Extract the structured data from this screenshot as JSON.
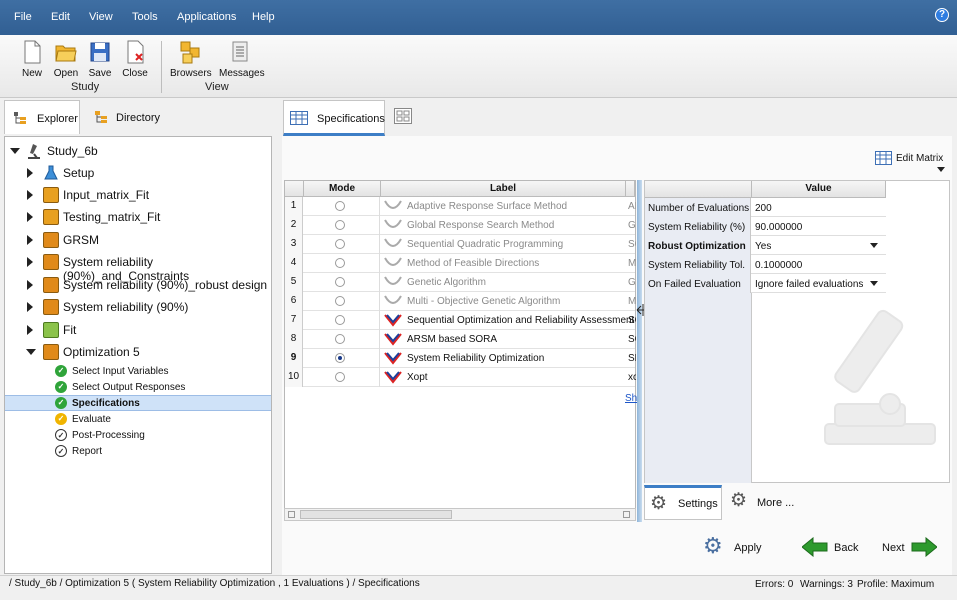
{
  "menu": [
    "File",
    "Edit",
    "View",
    "Tools",
    "Applications",
    "Help"
  ],
  "help_label": "?",
  "toolbar": {
    "study": {
      "new": "New",
      "open": "Open",
      "save": "Save",
      "close": "Close",
      "group": "Study"
    },
    "view": {
      "browsers": "Browsers",
      "messages": "Messages",
      "group": "View"
    }
  },
  "left_tabs": {
    "explorer": "Explorer",
    "directory": "Directory"
  },
  "tree": {
    "root": "Study_6b",
    "items": [
      "Setup",
      "Input_matrix_Fit",
      "Testing_matrix_Fit",
      "GRSM",
      "System reliability (90%)_and_Constraints",
      "System reliability (90%)_robust design",
      "System reliability (90%)",
      "Fit",
      "Optimization 5"
    ],
    "children": [
      "Select Input Variables",
      "Select Output Responses",
      "Specifications",
      "Evaluate",
      "Post-Processing",
      "Report"
    ]
  },
  "right_tabs": {
    "specifications": "Specifications"
  },
  "edit_matrix": "Edit Matrix",
  "grid": {
    "headers": [
      "Mode",
      "Label"
    ],
    "rows": [
      {
        "n": "1",
        "label": "Adaptive Response Surface Method",
        "extra": "AI",
        "enabled": false,
        "selected": false
      },
      {
        "n": "2",
        "label": "Global Response Search Method",
        "extra": "Gl",
        "enabled": false,
        "selected": false
      },
      {
        "n": "3",
        "label": "Sequential Quadratic Programming",
        "extra": "SC",
        "enabled": false,
        "selected": false
      },
      {
        "n": "4",
        "label": "Method of Feasible Directions",
        "extra": "M",
        "enabled": false,
        "selected": false
      },
      {
        "n": "5",
        "label": "Genetic Algorithm",
        "extra": "G/",
        "enabled": false,
        "selected": false
      },
      {
        "n": "6",
        "label": "Multi - Objective Genetic Algorithm",
        "extra": "M",
        "enabled": false,
        "selected": false
      },
      {
        "n": "7",
        "label": "Sequential Optimization and Reliability Assessment",
        "extra": "SC",
        "enabled": true,
        "selected": false
      },
      {
        "n": "8",
        "label": "ARSM based SORA",
        "extra": "SC",
        "enabled": true,
        "selected": false
      },
      {
        "n": "9",
        "label": "System Reliability Optimization",
        "extra": "SF",
        "enabled": true,
        "selected": true
      },
      {
        "n": "10",
        "label": "Xopt",
        "extra": "xc",
        "enabled": true,
        "selected": false
      }
    ],
    "show_link": "Sh"
  },
  "props": {
    "header": "Value",
    "rows": [
      {
        "key": "Number of Evaluations",
        "value": "200",
        "bold": false,
        "dropdown": false
      },
      {
        "key": "System Reliability (%)",
        "value": "90.000000",
        "bold": false,
        "dropdown": false
      },
      {
        "key": "Robust Optimization",
        "value": "Yes",
        "bold": true,
        "dropdown": true
      },
      {
        "key": "System Reliability Tol.",
        "value": "0.1000000",
        "bold": false,
        "dropdown": false
      },
      {
        "key": "On Failed Evaluation",
        "value": "Ignore failed evaluations",
        "bold": false,
        "dropdown": true
      }
    ]
  },
  "bottom_tabs": {
    "settings": "Settings",
    "more": "More ..."
  },
  "buttons": {
    "apply": "Apply",
    "back": "Back",
    "next": "Next"
  },
  "status": {
    "path": "/ Study_6b / Optimization 5 ( System Reliability Optimization , 1 Evaluations ) / Specifications",
    "errors": "Errors: 0",
    "warnings": "Warnings: 3",
    "profile": "Profile: Maximum"
  }
}
